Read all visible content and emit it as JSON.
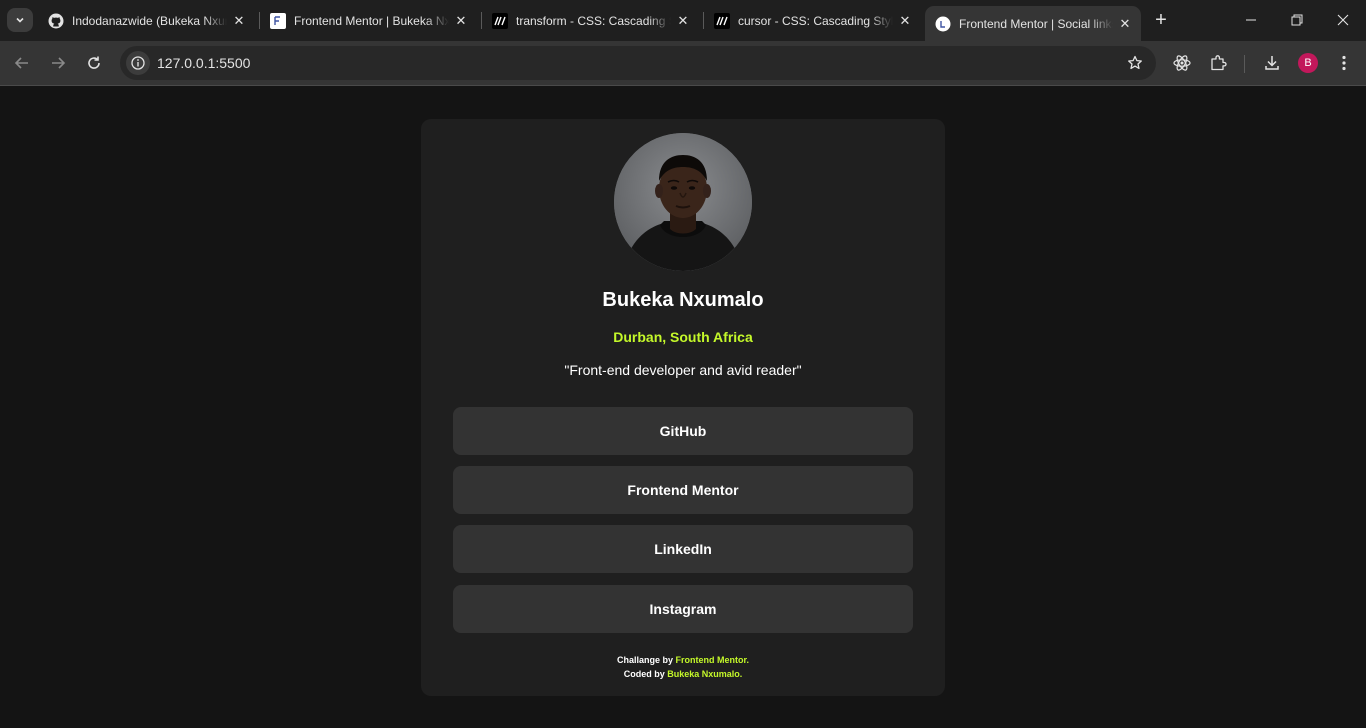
{
  "browser": {
    "tabs": [
      {
        "title": "Indodanazwide (Bukeka Nxumalo)",
        "favicon": "github-icon",
        "active": false
      },
      {
        "title": "Frontend Mentor | Bukeka Nxumalo",
        "favicon": "frontend-mentor-icon",
        "active": false
      },
      {
        "title": "transform - CSS: Cascading Style Sheets",
        "favicon": "mdn-icon",
        "active": false
      },
      {
        "title": "cursor - CSS: Cascading Style Sheets",
        "favicon": "mdn-icon",
        "active": false
      },
      {
        "title": "Frontend Mentor | Social links profile",
        "favicon": "frontend-mentor-icon",
        "active": true
      }
    ],
    "url": "127.0.0.1:5500",
    "profile_initial": "B",
    "profile_color": "#c2185b"
  },
  "profile": {
    "name": "Bukeka Nxumalo",
    "location": "Durban, South Africa",
    "bio": "\"Front-end developer and avid reader\"",
    "links": [
      "GitHub",
      "Frontend Mentor",
      "LinkedIn",
      "Instagram"
    ]
  },
  "footer": {
    "challenge_prefix": "Challange by ",
    "challenge_link": "Frontend Mentor",
    "challenge_suffix": ".",
    "coded_prefix": "Coded by ",
    "coded_link": "Bukeka Nxumalo",
    "coded_suffix": "."
  },
  "colors": {
    "accent": "#c4f82a",
    "card": "#1f1f1f",
    "button": "#333333",
    "page": "#141414"
  }
}
